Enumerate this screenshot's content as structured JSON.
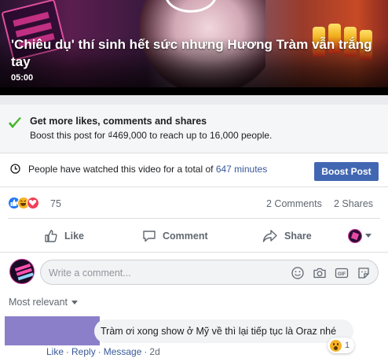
{
  "video": {
    "title": "'Chiêu dụ' thí sinh hết sức nhưng Hương Tràm vẫn trắng tay",
    "duration": "05:00"
  },
  "boost_banner": {
    "headline": "Get more likes, comments and shares",
    "subtext": "Boost this post for ₫469,000 to reach up to 16,000 people."
  },
  "insight": {
    "text_before": "People have watched this video for a total of ",
    "minutes": "647 minutes",
    "boost_button": "Boost Post"
  },
  "reactions": {
    "types": [
      "like",
      "haha",
      "love"
    ],
    "count": "75",
    "comments": "2 Comments",
    "shares": "2 Shares"
  },
  "actions": {
    "like": "Like",
    "comment": "Comment",
    "share": "Share"
  },
  "composer": {
    "placeholder": "Write a comment...",
    "icons": [
      "emoji-icon",
      "camera-icon",
      "gif-icon",
      "sticker-icon"
    ]
  },
  "sort_label": "Most relevant",
  "comment": {
    "text": "Tràm ơi xong show ở Mỹ về thì lại tiếp tục là Oraz nhé",
    "reaction": "wow",
    "reaction_count": "1",
    "like": "Like",
    "reply": "Reply",
    "message": "Message",
    "time": "2d"
  },
  "colors": {
    "brand_blue": "#4267b2",
    "link_blue": "#385898",
    "like_blue": "#2078f4",
    "love_red": "#f33e58",
    "haha_yellow": "#f7b125",
    "check_green": "#42b72a",
    "redaction_purple": "#8c7fc9"
  }
}
